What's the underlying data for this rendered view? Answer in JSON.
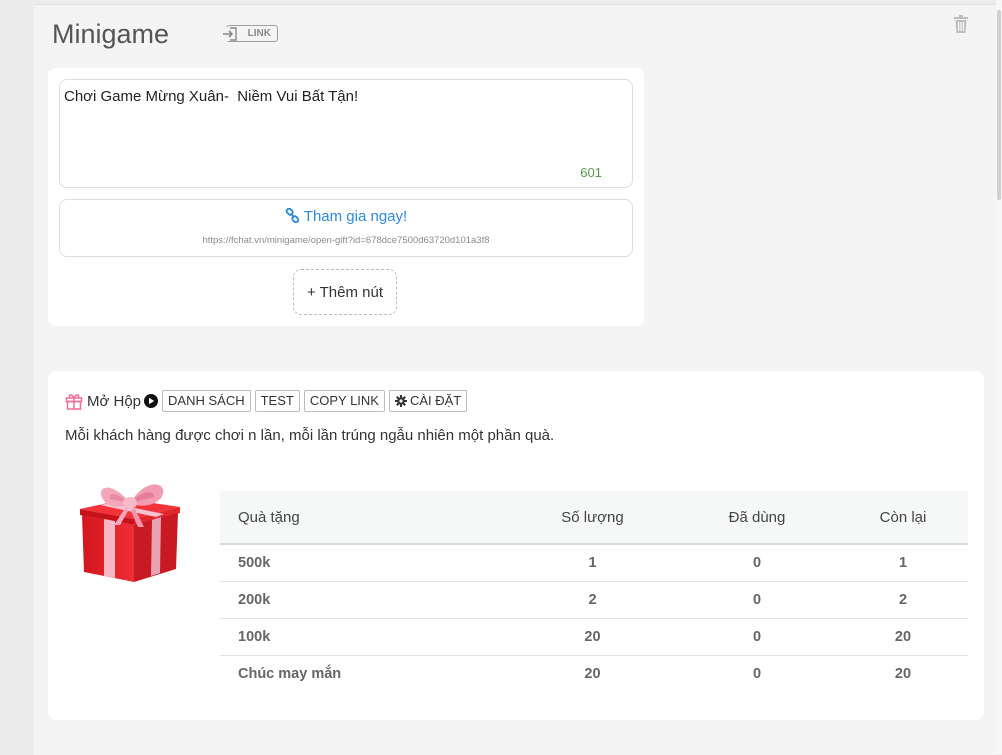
{
  "header": {
    "title": "Minigame",
    "link_badge": "LINK"
  },
  "message": {
    "text": "Chơi Game Mừng Xuân-  Niềm Vui Bất Tận!",
    "char_count": "601"
  },
  "join_button": {
    "label": "Tham gia ngay!",
    "url": "https://fchat.vn/minigame/open-gift?id=678dce7500d63720d101a3f8"
  },
  "add_button": {
    "label": "+ Thêm nút"
  },
  "game": {
    "name": "Mở Hộp",
    "buttons": {
      "list": "DANH SÁCH",
      "test": "TEST",
      "copy_link": "COPY LINK",
      "settings": "CÀI ĐẶT"
    },
    "description": "Mỗi khách hàng được chơi n lần, mỗi lần trúng ngẫu nhiên một phần quà.",
    "table": {
      "columns": [
        "Quà tặng",
        "Số lượng",
        "Đã dùng",
        "Còn lại"
      ],
      "rows": [
        [
          "500k",
          "1",
          "0",
          "1"
        ],
        [
          "200k",
          "2",
          "0",
          "2"
        ],
        [
          "100k",
          "20",
          "0",
          "20"
        ],
        [
          "Chúc may mắn",
          "20",
          "0",
          "20"
        ]
      ]
    }
  },
  "colors": {
    "accent_link": "#2f8ad8",
    "count_green": "#5a9a4c",
    "gift_pink": "#f06a9a"
  }
}
